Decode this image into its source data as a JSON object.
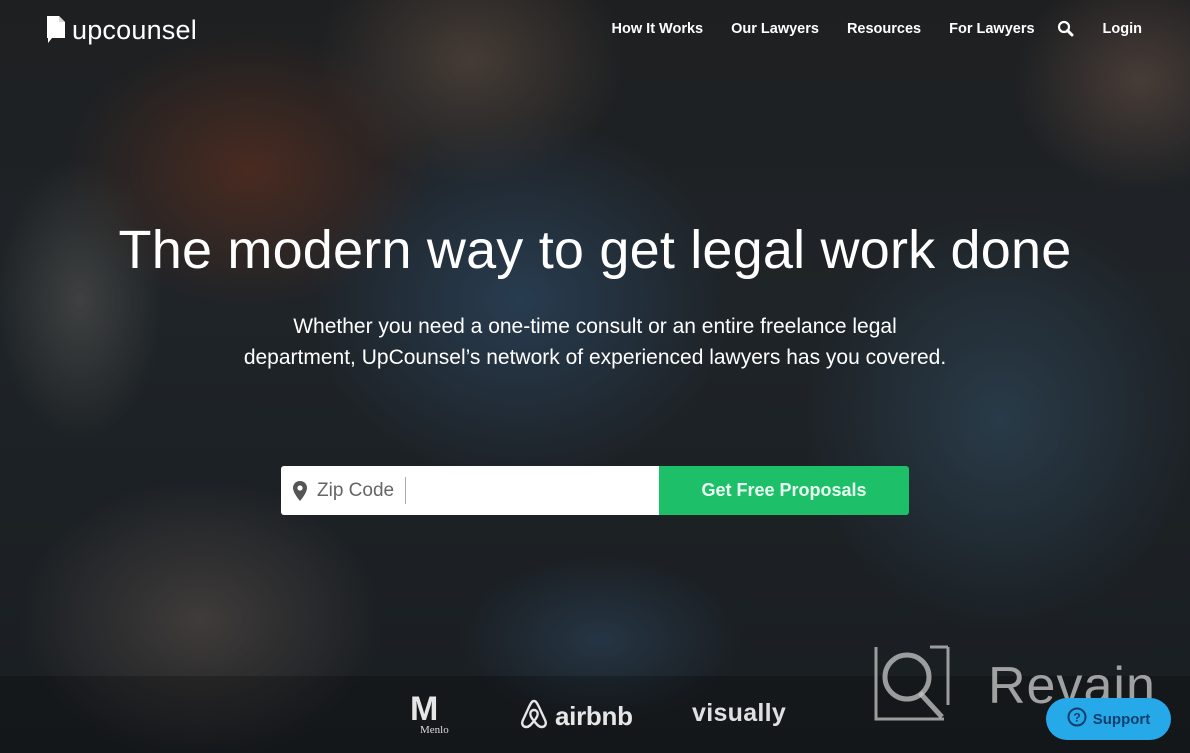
{
  "brand": {
    "name": "upcounsel"
  },
  "nav": {
    "items": [
      {
        "label": "How It Works"
      },
      {
        "label": "Our Lawyers"
      },
      {
        "label": "Resources"
      },
      {
        "label": "For Lawyers"
      }
    ],
    "search_icon": "search-icon",
    "login_label": "Login"
  },
  "hero": {
    "headline": "The modern way to get legal work done",
    "subheadline_line1": "Whether you need a one-time consult or an entire freelance legal",
    "subheadline_line2": "department, UpCounsel’s network of experienced lawyers has you covered."
  },
  "search": {
    "zip_placeholder": "Zip Code",
    "zip_value": "",
    "pin_icon": "map-pin-icon",
    "cta_label": "Get Free Proposals"
  },
  "client_logos": [
    {
      "name": "Menlo",
      "mark": "M",
      "caption": "Menlo"
    },
    {
      "name": "airbnb",
      "text": "airbnb"
    },
    {
      "name": "visually",
      "text": "visually"
    }
  ],
  "watermark": {
    "text": "Revain"
  },
  "support": {
    "label": "Support",
    "icon": "question-circle-icon"
  },
  "colors": {
    "cta_green": "#1dbf68",
    "support_blue": "#26a9e8",
    "text": "#ffffff"
  }
}
